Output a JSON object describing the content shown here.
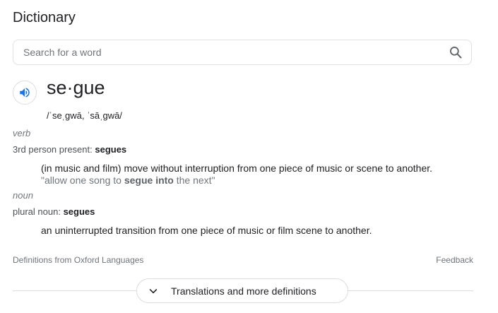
{
  "header": {
    "title": "Dictionary"
  },
  "search": {
    "placeholder": "Search for a word",
    "value": "",
    "icon": "search-icon"
  },
  "entry": {
    "audio_icon": "speaker-icon",
    "word": "se·gue",
    "phonetic": "/ˈseˌɡwā, ˈsāˌɡwā/",
    "senses": [
      {
        "part_of_speech": "verb",
        "form_label": "3rd person present",
        "form_separator": ": ",
        "form_value": "segues",
        "definition": "(in music and film) move without interruption from one piece of music or scene to another.",
        "example": {
          "open_quote": "\"",
          "before": "allow one song to ",
          "highlight": "segue into",
          "after": " the next",
          "close_quote": "\""
        }
      },
      {
        "part_of_speech": "noun",
        "form_label": "plural noun",
        "form_separator": ": ",
        "form_value": "segues",
        "definition": "an uninterrupted transition from one piece of music or film scene to another."
      }
    ]
  },
  "footer": {
    "source": "Definitions from Oxford Languages",
    "feedback": "Feedback",
    "more_button": "Translations and more definitions",
    "more_icon": "chevron-down-icon"
  },
  "colors": {
    "text_primary": "#202124",
    "text_secondary": "#70757a",
    "speaker_blue": "#1a73e8",
    "border": "#dadce0"
  }
}
